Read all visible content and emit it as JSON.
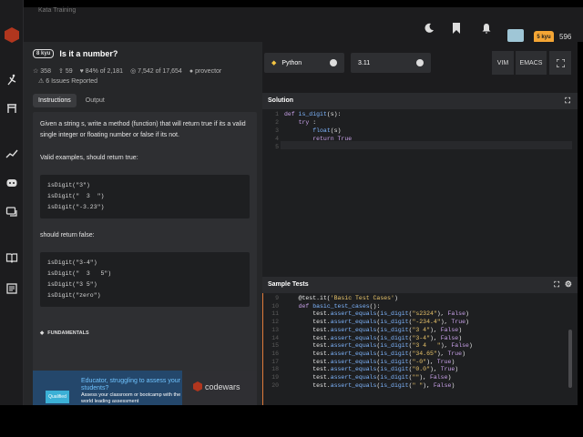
{
  "header": {
    "crumb": "Kata Training",
    "rank": "5 kyu",
    "honor": "596"
  },
  "kata": {
    "kyu": "8 kyu",
    "title": "Is it a number?",
    "stats": {
      "favorites": "358",
      "votes": "59",
      "satisfaction": "84% of 2,181",
      "completed": "7,542 of 17,654",
      "author": "provector"
    },
    "issues": "6 Issues Reported",
    "tabs": [
      "Instructions",
      "Output"
    ],
    "description": {
      "intro": "Given a string s, write a method (function) that will return true if its a valid single integer or floating number or false if its not.",
      "valid_heading": "Valid examples, should return true:",
      "valid_examples": [
        "isDigit(\"3\")",
        "isDigit(\"  3  \")",
        "isDigit(\"-3.23\")"
      ],
      "false_heading": "should return false:",
      "false_examples": [
        "isDigit(\"3-4\")",
        "isDigit(\"  3   5\")",
        "isDigit(\"3 5\")",
        "isDigit(\"zero\")"
      ],
      "tag": "FUNDAMENTALS"
    },
    "ad": {
      "logo": "Qualified",
      "title": "Educator, struggling to assess your students?",
      "body": "Assess your classroom or bootcamp with the world leading assessment",
      "brand": "codewars"
    }
  },
  "editor": {
    "language": "Python",
    "version": "3.11",
    "modes": [
      "VIM",
      "EMACS"
    ],
    "solution_title": "Solution",
    "solution_lines": [
      {
        "n": "1",
        "code": "def is_digit(s):"
      },
      {
        "n": "2",
        "code": "    try :"
      },
      {
        "n": "3",
        "code": "        float(s)"
      },
      {
        "n": "4",
        "code": "        return True"
      },
      {
        "n": "5",
        "code": ""
      }
    ],
    "tests_title": "Sample Tests",
    "test_lines": [
      {
        "n": "9",
        "code": "    @test.it('Basic Test Cases')"
      },
      {
        "n": "10",
        "code": "    def basic_test_cases():"
      },
      {
        "n": "11",
        "code": "        test.assert_equals(is_digit(\"s2324\"), False)"
      },
      {
        "n": "12",
        "code": "        test.assert_equals(is_digit(\"-234.4\"), True)"
      },
      {
        "n": "13",
        "code": "        test.assert_equals(is_digit(\"3 4\"), False)"
      },
      {
        "n": "14",
        "code": "        test.assert_equals(is_digit(\"3-4\"), False)"
      },
      {
        "n": "15",
        "code": "        test.assert_equals(is_digit(\"3 4   \"), False)"
      },
      {
        "n": "16",
        "code": "        test.assert_equals(is_digit(\"34.65\"), True)"
      },
      {
        "n": "17",
        "code": "        test.assert_equals(is_digit(\"-0\"), True)"
      },
      {
        "n": "18",
        "code": "        test.assert_equals(is_digit(\"0.0\"), True)"
      },
      {
        "n": "19",
        "code": "        test.assert_equals(is_digit(\"\"), False)"
      },
      {
        "n": "20",
        "code": "        test.assert_equals(is_digit(\" \"), False)"
      }
    ]
  }
}
